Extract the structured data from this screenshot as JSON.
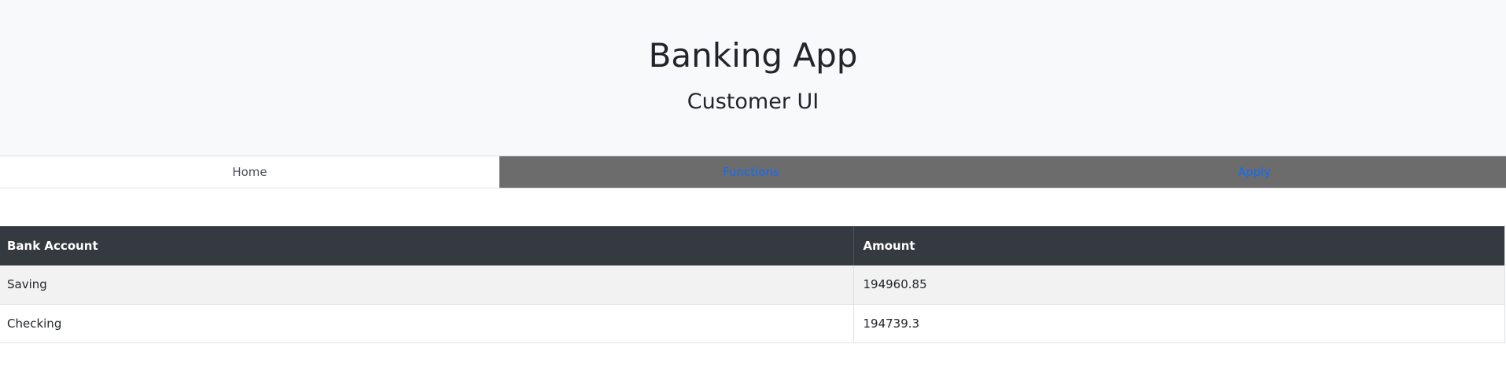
{
  "header": {
    "title": "Banking App",
    "subtitle": "Customer UI"
  },
  "nav": {
    "tabs": [
      {
        "label": "Home"
      },
      {
        "label": "Functions"
      },
      {
        "label": "Apply"
      }
    ]
  },
  "accounts_table": {
    "columns": [
      "Bank Account",
      "Amount"
    ],
    "rows": [
      {
        "account": "Saving",
        "amount": "194960.85"
      },
      {
        "account": "Checking",
        "amount": "194739.3"
      }
    ]
  },
  "colors": {
    "header_bg": "#f8f9fa",
    "tab_inactive_bg": "#6c6c6c",
    "link": "#0d6efd",
    "table_head_bg": "#343a40",
    "stripe_bg": "#f2f2f2"
  }
}
